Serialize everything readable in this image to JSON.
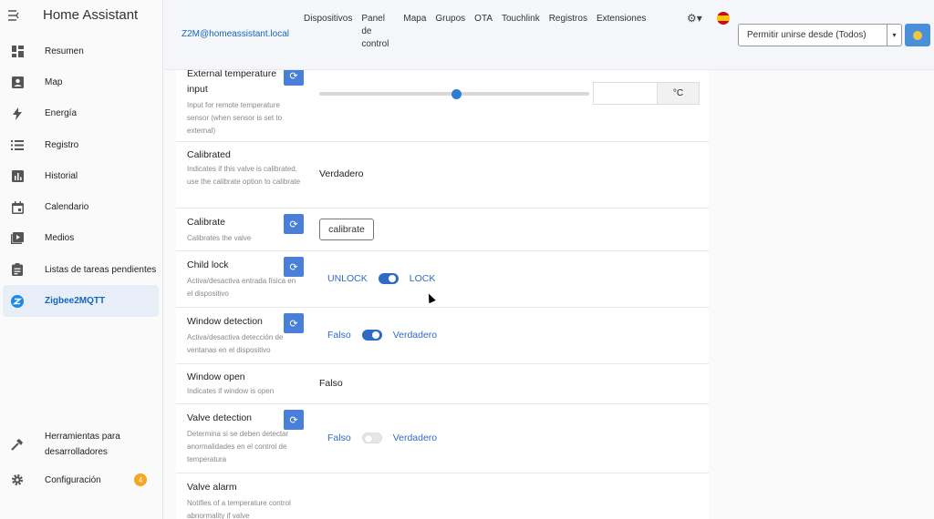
{
  "app": {
    "title": "Home Assistant"
  },
  "sidebar": {
    "items": [
      {
        "label": "Resumen",
        "icon": "dashboard-icon"
      },
      {
        "label": "Map",
        "icon": "account-box-icon"
      },
      {
        "label": "Energía",
        "icon": "lightning-icon"
      },
      {
        "label": "Registro",
        "icon": "list-icon"
      },
      {
        "label": "Historial",
        "icon": "chart-icon"
      },
      {
        "label": "Calendario",
        "icon": "calendar-icon"
      },
      {
        "label": "Medios",
        "icon": "play-icon"
      },
      {
        "label": "Listas de tareas pendientes",
        "icon": "clipboard-icon"
      },
      {
        "label": "Zigbee2MQTT",
        "icon": "zigbee-icon",
        "active": true
      }
    ],
    "bottom": [
      {
        "label": "Herramientas para desarrolladores",
        "icon": "hammer-icon"
      },
      {
        "label": "Configuración",
        "icon": "gear-icon",
        "badge": "4"
      }
    ]
  },
  "topbar": {
    "host": "Z2M@homeassistant.local",
    "nav": [
      "Dispositivos",
      "Panel de control",
      "Mapa",
      "Grupos",
      "OTA",
      "Touchlink",
      "Registros",
      "Extensiones"
    ],
    "permit_join": "Permitir unirse desde (Todos)"
  },
  "rows": {
    "external_temp": {
      "name": "External temperature input",
      "desc": "Input for remote temperature sensor (when sensor is set to external)",
      "unit": "°C"
    },
    "calibrated": {
      "name": "Calibrated",
      "desc": "Indicates if this valve is calibrated, use the calibrate option to calibrate",
      "value": "Verdadero"
    },
    "calibrate": {
      "name": "Calibrate",
      "desc": "Calibrates the valve",
      "button": "calibrate"
    },
    "child_lock": {
      "name": "Child lock",
      "desc": "Activa/desactiva entrada física en el dispositivo",
      "off_label": "UNLOCK",
      "on_label": "LOCK"
    },
    "window_detection": {
      "name": "Window detection",
      "desc": "Activa/desactiva detección de ventanas en el dispositivo",
      "off_label": "Falso",
      "on_label": "Verdadero"
    },
    "window_open": {
      "name": "Window open",
      "desc": "Indicates if window is open",
      "value": "Falso"
    },
    "valve_detection": {
      "name": "Valve detection",
      "desc": "Determina si se deben detectar anormalidades en el control de temperatura",
      "off_label": "Falso",
      "on_label": "Verdadero"
    },
    "valve_alarm": {
      "name": "Valve alarm",
      "desc": "Notifies of a temperature control abnormality if valve"
    }
  },
  "colors": {
    "accent": "#2e6bc6",
    "refresh_button": "#4a7fd9",
    "badge": "#f5a623"
  }
}
